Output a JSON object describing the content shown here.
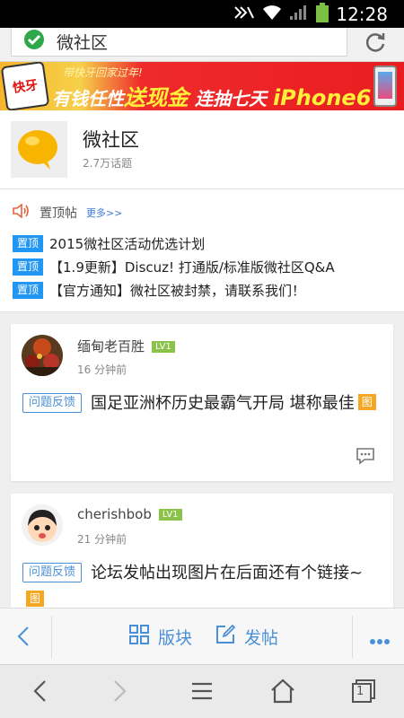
{
  "status_bar": {
    "time": "12:28"
  },
  "address_bar": {
    "url_text": "微社区"
  },
  "banner": {
    "logo_text": "快牙",
    "top_text": "带快牙回家过年!",
    "main_prefix": "有钱任性",
    "main_highlight": "送现金",
    "main_suffix": "连抽七天",
    "main_product": "iPhone6"
  },
  "forum": {
    "title": "微社区",
    "topic_count": "2.7万话题"
  },
  "pinned": {
    "label": "置顶帖",
    "more": "更多>>",
    "tag": "置顶",
    "items": [
      "2015微社区活动优选计划",
      "【1.9更新】Discuz! 打通版/标准版微社区Q&A",
      "【官方通知】微社区被封禁，请联系我们！"
    ]
  },
  "posts": [
    {
      "username": "缅甸老百胜",
      "level": "LV1",
      "time": "16 分钟前",
      "category": "问题反馈",
      "title": "国足亚洲杯历史最霸气开局 堪称最佳",
      "image_tag": "图"
    },
    {
      "username": "cherishbob",
      "level": "LV1",
      "time": "21 分钟前",
      "category": "问题反馈",
      "title": "论坛发帖出现图片在后面还有个链接~",
      "image_tag": "图"
    }
  ],
  "app_bar": {
    "sections_label": "版块",
    "post_label": "发帖"
  },
  "nav_bar": {
    "tab_count": "1"
  },
  "colors": {
    "accent": "#4a90d9",
    "pin_tag": "#2196f3",
    "level_badge": "#8bc34a",
    "image_badge": "#f5a623"
  }
}
